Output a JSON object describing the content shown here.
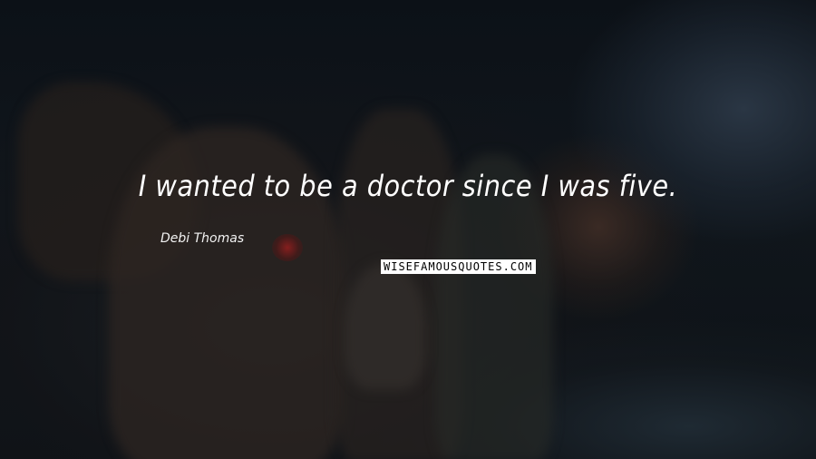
{
  "quote": {
    "text": "I wanted to be a doctor since I was five.",
    "author": "Debi Thomas"
  },
  "watermark": {
    "text": "WISEFAMOUSQUOTES.COM"
  },
  "colors": {
    "background": "#0b0f14",
    "text": "#ffffff",
    "watermark_bg": "#ffffff",
    "watermark_text": "#000000"
  }
}
